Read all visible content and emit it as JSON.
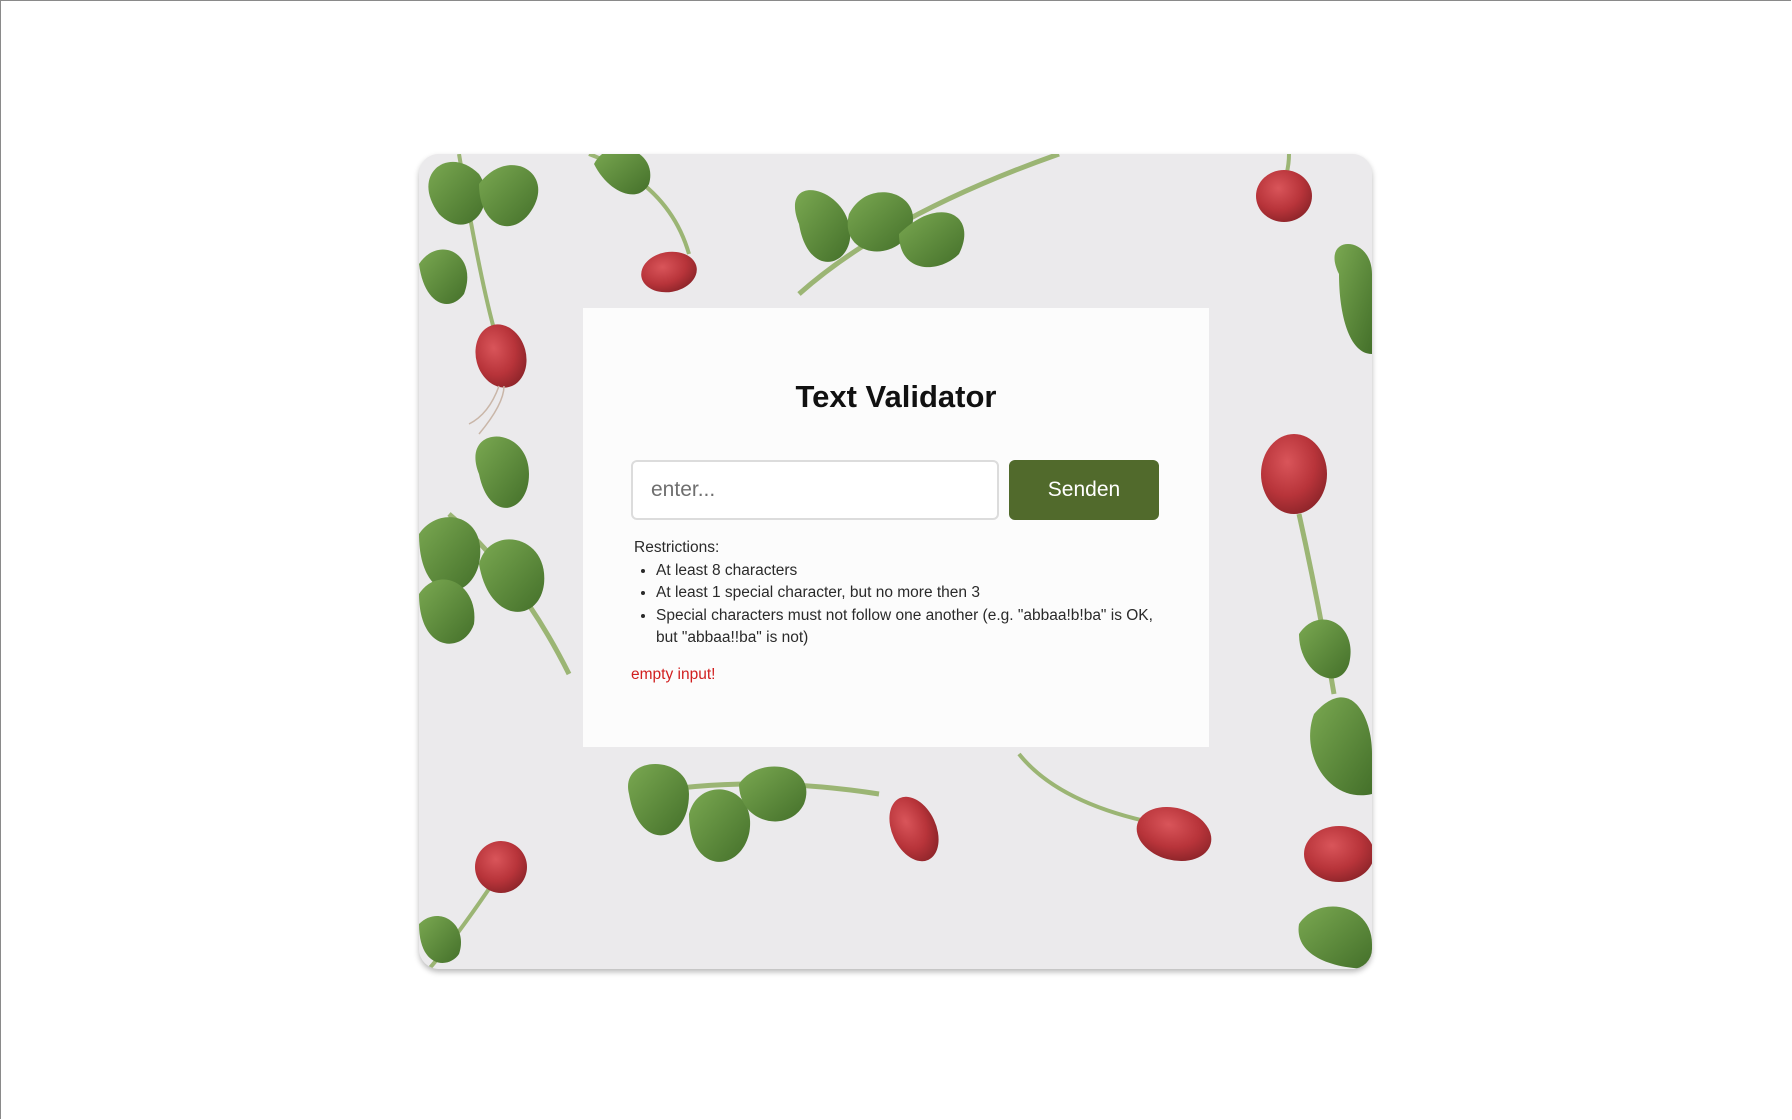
{
  "validator": {
    "title": "Text Validator",
    "input_placeholder": "enter...",
    "input_value": "",
    "submit_label": "Senden",
    "restrictions_heading": "Restrictions:",
    "restrictions": [
      "At least 8 characters",
      "At least 1 special character, but no more then 3",
      "Special characters must not follow one another (e.g. \"abbaa!b!ba\" is OK, but \"abbaa!!ba\" is not)"
    ],
    "error_message": "empty input!"
  },
  "colors": {
    "button_background": "#516a2c",
    "error_text": "#d11f1f",
    "photo_background": "#ebeaec",
    "radish_red": "#b8343a",
    "leaf_green": "#5b8a3a"
  },
  "icons": {
    "background_photo": "radish-photo-background"
  }
}
